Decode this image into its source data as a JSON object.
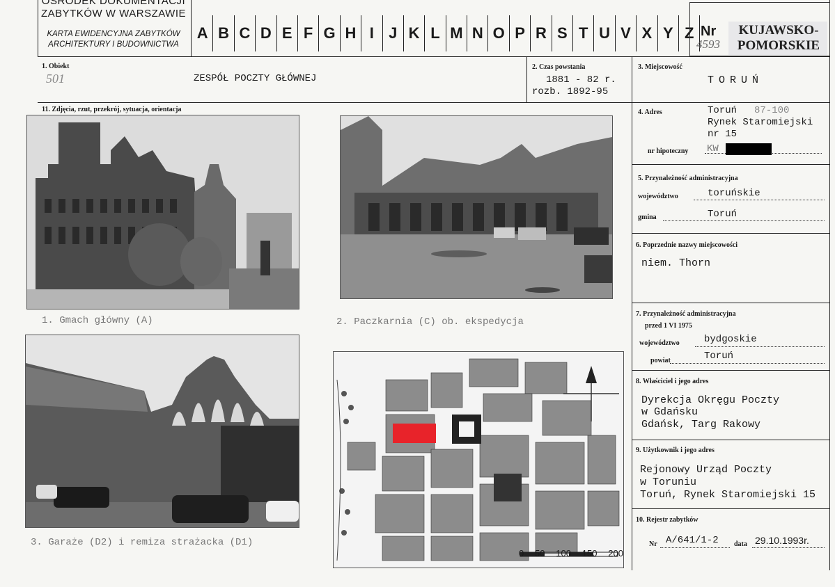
{
  "header": {
    "institution_line1": "OŚRODEK DOKUMENTACJI",
    "institution_line2": "ZABYTKÓW W WARSZAWIE",
    "card_line1": "KARTA EWIDENCYJNA ZABYTKÓW",
    "card_line2": "ARCHITEKTURY I BUDOWNICTWA",
    "letters": [
      "A",
      "B",
      "C",
      "D",
      "E",
      "F",
      "G",
      "H",
      "I",
      "J",
      "K",
      "L",
      "M",
      "N",
      "O",
      "P",
      "R",
      "S",
      "T",
      "U",
      "V",
      "X",
      "Y",
      "Z"
    ],
    "nr_label": "Nr",
    "nr_value": "4593",
    "region_line1": "KUJAWSKO-",
    "region_line2": "POMORSKIE"
  },
  "fields": {
    "obiekt_label": "1. Obiekt",
    "obiekt_number": "501",
    "obiekt_name": "ZESPÓŁ POCZTY GŁÓWNEJ",
    "czas_label": "2. Czas powstania",
    "czas_value1": "1881 - 82 r.",
    "czas_value2": "rozb. 1892-95",
    "miejscowosc_label": "3. Miejscowość",
    "miejscowosc_value": "TORUŃ",
    "zdjecia_label": "11. Zdjęcia, rzut, przekrój, sytuacja, orientacja",
    "adres_label": "4. Adres",
    "adres_line1": "Toruń",
    "adres_zip": "87-100",
    "adres_line2": "Rynek Staromiejski",
    "adres_line3": "nr 15",
    "hipoteczny_label": "nr hipoteczny",
    "hipoteczny_value": "KW",
    "admin_label": "5. Przynależność administracyjna",
    "woj_label": "województwo",
    "woj_value": "toruńskie",
    "gmina_label": "gmina",
    "gmina_value": "Toruń",
    "poprz_label": "6. Poprzednie nazwy miejscowości",
    "poprz_value": "niem. Thorn",
    "admin75_label": "7. Przynależność administracyjna",
    "admin75_sub": "przed 1 VI 1975",
    "woj75_label": "województwo",
    "woj75_value": "bydgoskie",
    "powiat_label": "powiat",
    "powiat_value": "Toruń",
    "wlasciciel_label": "8. Właściciel i jego adres",
    "wlasciciel_line1": "Dyrekcja Okręgu Poczty",
    "wlasciciel_line2": "w Gdańsku",
    "wlasciciel_line3": "Gdańsk, Targ Rakowy",
    "uzytkownik_label": "9. Użytkownik i jego adres",
    "uzytkownik_line1": "Rejonowy Urząd Poczty",
    "uzytkownik_line2": "w Toruniu",
    "uzytkownik_line3": "Toruń, Rynek Staromiejski 15",
    "rejestr_label": "10. Rejestr zabytków",
    "rejestr_nr_label": "Nr",
    "rejestr_nr_value": "A/641/1-2",
    "rejestr_data_label": "data",
    "rejestr_data_value": "29.10.1993r."
  },
  "captions": {
    "photo1": "1. Gmach główny (A)",
    "photo2": "2. Paczkarnia (C) ob. ekspedycja",
    "photo3": "3. Garaże (D2) i remiza strażacka (D1)"
  },
  "map": {
    "scale_labels": [
      "0",
      "50",
      "100",
      "150",
      "200"
    ],
    "highlight_color": "#e8232a"
  }
}
